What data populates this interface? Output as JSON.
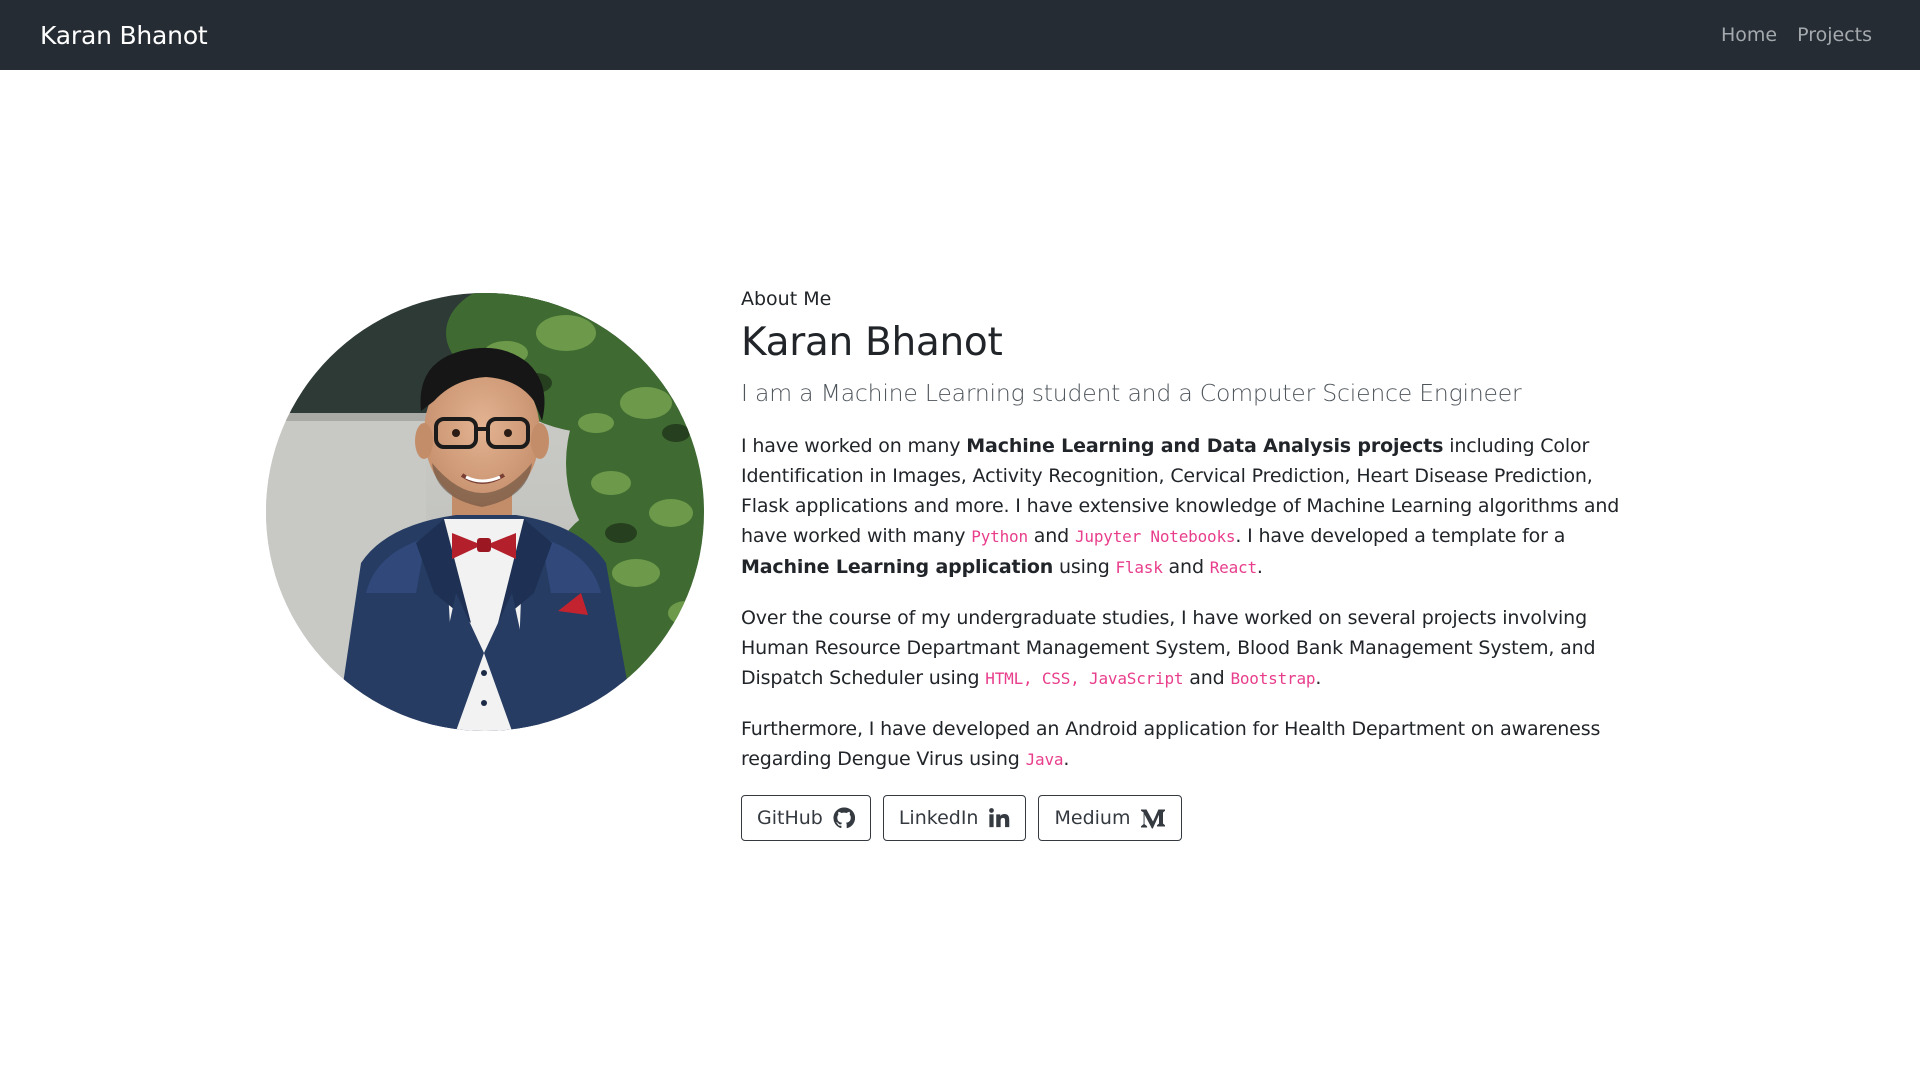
{
  "navbar": {
    "brand": "Karan Bhanot",
    "links": [
      {
        "label": "Home"
      },
      {
        "label": "Projects"
      }
    ]
  },
  "about": {
    "section_label": "About Me",
    "name": "Karan Bhanot",
    "tagline": "I am a Machine Learning student and a Computer Science Engineer",
    "paragraph1": {
      "t1": "I have worked on many ",
      "b1": "Machine Learning and Data Analysis projects",
      "t2": " including Color Identification in Images, Activity Recognition, Cervical Prediction, Heart Disease Prediction, Flask applications and more. I have extensive knowledge of Machine Learning algorithms and have worked with many ",
      "c1": "Python",
      "t3": " and ",
      "c2": "Jupyter Notebooks",
      "t4": ". I have developed a template for a ",
      "b2": "Machine Learning application",
      "t5": " using ",
      "c3": "Flask",
      "t6": " and ",
      "c4": "React",
      "t7": "."
    },
    "paragraph2": {
      "t1": "Over the course of my undergraduate studies, I have worked on several projects involving Human Resource Departmant Management System, Blood Bank Management System, and Dispatch Scheduler using ",
      "c1": "HTML, CSS, JavaScript",
      "t2": " and ",
      "c2": "Bootstrap",
      "t3": "."
    },
    "paragraph3": {
      "t1": "Furthermore, I have developed an Android application for Health Department on awareness regarding Dengue Virus using ",
      "c1": "Java",
      "t2": "."
    },
    "buttons": [
      {
        "label": "GitHub",
        "icon": "github-icon"
      },
      {
        "label": "LinkedIn",
        "icon": "linkedin-icon"
      },
      {
        "label": "Medium",
        "icon": "medium-icon"
      }
    ]
  },
  "colors": {
    "navbar_bg": "#252c34",
    "code": "#e83e8c",
    "text": "#212529",
    "button_border": "#343a40"
  }
}
